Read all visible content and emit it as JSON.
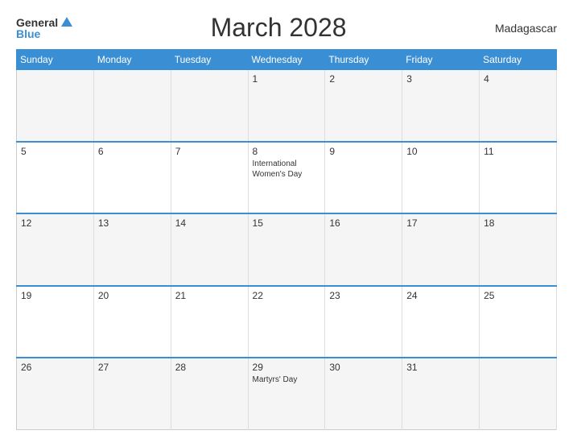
{
  "header": {
    "logo_general": "General",
    "logo_blue": "Blue",
    "title": "March 2028",
    "country": "Madagascar"
  },
  "days": {
    "sunday": "Sunday",
    "monday": "Monday",
    "tuesday": "Tuesday",
    "wednesday": "Wednesday",
    "thursday": "Thursday",
    "friday": "Friday",
    "saturday": "Saturday"
  },
  "weeks": [
    {
      "row": 1,
      "days": [
        {
          "date": "",
          "holiday": ""
        },
        {
          "date": "",
          "holiday": ""
        },
        {
          "date": "",
          "holiday": ""
        },
        {
          "date": "1",
          "holiday": ""
        },
        {
          "date": "2",
          "holiday": ""
        },
        {
          "date": "3",
          "holiday": ""
        },
        {
          "date": "4",
          "holiday": ""
        }
      ]
    },
    {
      "row": 2,
      "days": [
        {
          "date": "5",
          "holiday": ""
        },
        {
          "date": "6",
          "holiday": ""
        },
        {
          "date": "7",
          "holiday": ""
        },
        {
          "date": "8",
          "holiday": "International Women's Day"
        },
        {
          "date": "9",
          "holiday": ""
        },
        {
          "date": "10",
          "holiday": ""
        },
        {
          "date": "11",
          "holiday": ""
        }
      ]
    },
    {
      "row": 3,
      "days": [
        {
          "date": "12",
          "holiday": ""
        },
        {
          "date": "13",
          "holiday": ""
        },
        {
          "date": "14",
          "holiday": ""
        },
        {
          "date": "15",
          "holiday": ""
        },
        {
          "date": "16",
          "holiday": ""
        },
        {
          "date": "17",
          "holiday": ""
        },
        {
          "date": "18",
          "holiday": ""
        }
      ]
    },
    {
      "row": 4,
      "days": [
        {
          "date": "19",
          "holiday": ""
        },
        {
          "date": "20",
          "holiday": ""
        },
        {
          "date": "21",
          "holiday": ""
        },
        {
          "date": "22",
          "holiday": ""
        },
        {
          "date": "23",
          "holiday": ""
        },
        {
          "date": "24",
          "holiday": ""
        },
        {
          "date": "25",
          "holiday": ""
        }
      ]
    },
    {
      "row": 5,
      "days": [
        {
          "date": "26",
          "holiday": ""
        },
        {
          "date": "27",
          "holiday": ""
        },
        {
          "date": "28",
          "holiday": ""
        },
        {
          "date": "29",
          "holiday": "Martyrs' Day"
        },
        {
          "date": "30",
          "holiday": ""
        },
        {
          "date": "31",
          "holiday": ""
        },
        {
          "date": "",
          "holiday": ""
        }
      ]
    }
  ]
}
